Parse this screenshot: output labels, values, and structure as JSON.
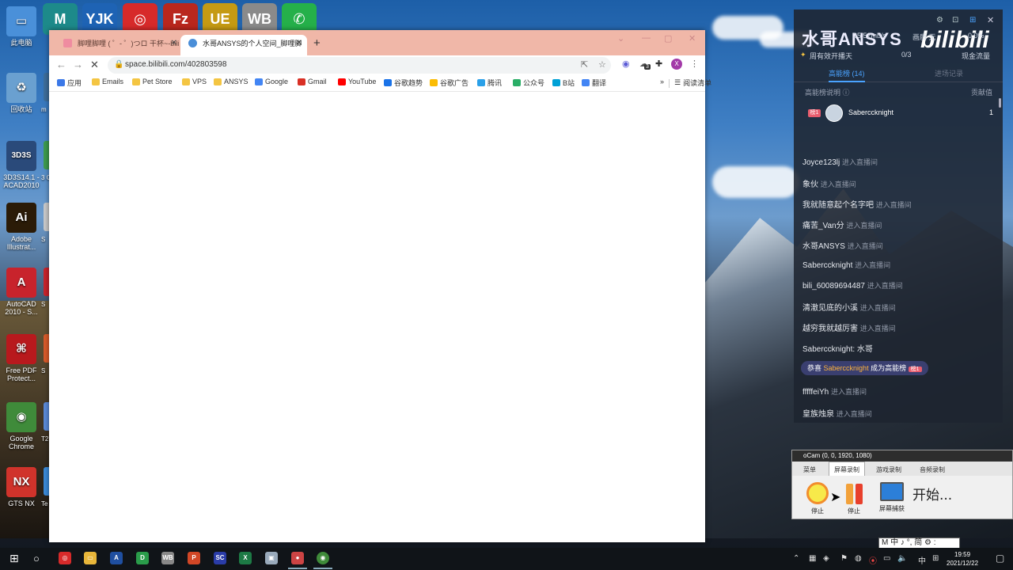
{
  "desktop": {
    "icons": [
      {
        "label": "此电脑",
        "glyph": "▭",
        "color": "#4a90d9"
      },
      {
        "label": "回收站",
        "glyph": "♻",
        "color": "#6aa0d0"
      },
      {
        "label": "3D3S14.1 - ACAD2010",
        "glyph": "3D3S",
        "color": "#2a4a7a"
      },
      {
        "label": "Adobe Illustrat...",
        "glyph": "Ai",
        "color": "#2b1b07"
      },
      {
        "label": "AutoCAD 2010 - S...",
        "glyph": "A",
        "color": "#c8232c"
      },
      {
        "label": "Free PDF Protect...",
        "glyph": "⌘",
        "color": "#b8191d"
      },
      {
        "label": "Google Chrome",
        "glyph": "◉",
        "color": "#3f8b3a"
      },
      {
        "label": "GTS NX",
        "glyph": "NX",
        "color": "#d0332b"
      }
    ],
    "partial_labels": [
      "m",
      "3 Co",
      "S",
      "S",
      "S",
      "T2",
      "Te"
    ],
    "top_icons": [
      {
        "name": "midas-icon",
        "glyph": "M",
        "color": "#1d8a8a"
      },
      {
        "name": "yjk-icon",
        "glyph": "YJK",
        "color": "#1e63b4"
      },
      {
        "name": "netease-music-icon",
        "glyph": "◎",
        "color": "#d72a2a"
      },
      {
        "name": "filezilla-icon",
        "glyph": "Fz",
        "color": "#b9271d"
      },
      {
        "name": "ue-editor-icon",
        "glyph": "UE",
        "color": "#c59a13"
      },
      {
        "name": "wb-icon",
        "glyph": "WB",
        "color": "#8a8a8a"
      },
      {
        "name": "whatsapp-icon",
        "glyph": "✆",
        "color": "#25b04a"
      }
    ]
  },
  "browser": {
    "tabs": [
      {
        "title": "脚哩脚哩 ( ゜- ゜)つロ 干杯~-bili",
        "active": false
      },
      {
        "title": "水哥ANSYS的个人空间_脚哩脚",
        "active": true
      }
    ],
    "new_tab": "+",
    "url": "space.bilibili.com/402803598",
    "extension_badge": "3",
    "profile_initial": "X",
    "bookmarks": [
      {
        "label": "应用",
        "color": "#3b78e7"
      },
      {
        "label": "Emails",
        "color": "#f4c542"
      },
      {
        "label": "Pet Store",
        "color": "#f4c542"
      },
      {
        "label": "VPS",
        "color": "#f4c542"
      },
      {
        "label": "ANSYS",
        "color": "#f4c542"
      },
      {
        "label": "Google",
        "color": "#4285f4"
      },
      {
        "label": "Gmail",
        "color": "#d93025"
      },
      {
        "label": "YouTube",
        "color": "#ff0000"
      },
      {
        "label": "谷歌趋势",
        "color": "#1a73e8"
      },
      {
        "label": "谷歌广告",
        "color": "#fbbc04"
      },
      {
        "label": "腾讯",
        "color": "#2aa0e8"
      },
      {
        "label": "公众号",
        "color": "#2aae67"
      },
      {
        "label": "B站",
        "color": "#00a1d6"
      },
      {
        "label": "翻译",
        "color": "#4285f4"
      }
    ],
    "bookmarks_more": "»",
    "reading_list": "阅读清单"
  },
  "live_panel": {
    "title": "水哥ANSYS",
    "logo": "bilibili",
    "meta_left": "35.52mb/s",
    "meta_mid": "画质 无",
    "meta_right": "0.0%",
    "streak": "周有效开播天",
    "progress": "0/3",
    "flow": "现金流量",
    "tab_active": "高能榜 (14)",
    "tab_inactive": "进场记录",
    "rank_label": "高能榜说明",
    "rank_right": "贡献值",
    "rank_entry": {
      "badge": "榜1",
      "name": "Sabercсknight",
      "score": "1"
    },
    "chat": [
      {
        "user": "Joyce123lj",
        "action": "进入直播间"
      },
      {
        "user": "象伙",
        "action": "进入直播间"
      },
      {
        "user": "我就随意起个名字吧",
        "action": "进入直播间"
      },
      {
        "user": "痛苦_Van分",
        "action": "进入直播间"
      },
      {
        "user": "水哥ANSYS",
        "action": "进入直播间"
      },
      {
        "user": "Sabercсknight",
        "action": "进入直播间"
      },
      {
        "user": "bili_60089694487",
        "action": "进入直播间"
      },
      {
        "user": "清澈见底的小溪",
        "action": "进入直播间"
      },
      {
        "user": "越穷我就越厉害",
        "action": "进入直播间"
      },
      {
        "user": "Sabercсknight: 水哥",
        "action": ""
      },
      {
        "user": "fffffeiYh",
        "action": "进入直播间"
      },
      {
        "user": "皇族烛泉",
        "action": "进入直播间"
      }
    ],
    "congrats_prefix": "恭喜",
    "congrats_name": "Sabercсknight",
    "congrats_suffix": "成为高能榜",
    "congrats_badge": "榜1"
  },
  "ocam": {
    "title": "oCam (0, 0, 1920, 1080)",
    "tabs": [
      "菜单",
      "屏幕录制",
      "游戏录制",
      "音频录制"
    ],
    "buttons": [
      "停止",
      "停止",
      "屏幕捕获"
    ],
    "start": "开始..."
  },
  "ime": "M 中 ♪ °, 简 ⚙ :",
  "taskbar": {
    "time": "19:59",
    "date": "2021/12/22"
  }
}
